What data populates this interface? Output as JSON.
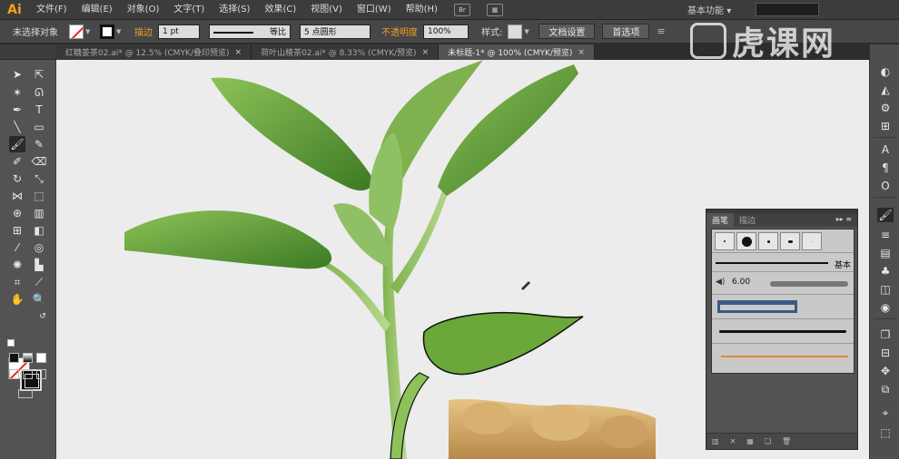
{
  "app": {
    "logo": "Ai"
  },
  "menu": [
    "文件(F)",
    "编辑(E)",
    "对象(O)",
    "文字(T)",
    "选择(S)",
    "效果(C)",
    "视图(V)",
    "窗口(W)",
    "帮助(H)"
  ],
  "menubar": {
    "br_icon": "Br",
    "workspace": "基本功能",
    "workspace_arrow": "▾"
  },
  "control": {
    "no_selection": "未选择对象",
    "stroke_label": "描边",
    "stroke_weight": "1 pt",
    "stroke_profile": "等比",
    "brush_def": "5 点圆形",
    "opacity_label": "不透明度",
    "opacity": "100%",
    "style_label": "样式:",
    "doc_setup": "文档设置",
    "preferences": "首选项"
  },
  "tabs": [
    {
      "label": "红糖姜茶02.ai* @ 12.5% (CMYK/叠印预览)",
      "active": false
    },
    {
      "label": "荷叶山楂茶02.ai* @ 8.33% (CMYK/预览)",
      "active": false
    },
    {
      "label": "未标题-1* @ 100% (CMYK/预览)",
      "active": true
    }
  ],
  "tab_close": "×",
  "brush_panel": {
    "tab_brushes": "画笔",
    "tab_stroke": "描边",
    "menu_glyph": "▸▸ ≡",
    "basic_label": "基本",
    "size_value": "6.00"
  },
  "watermark": {
    "text": "虎课网"
  },
  "colors": {
    "accent_orange": "#f0a020",
    "leaf_green": "#6aa83a",
    "leaf_dark": "#3e7a22",
    "stroke_red": "#e22222"
  }
}
